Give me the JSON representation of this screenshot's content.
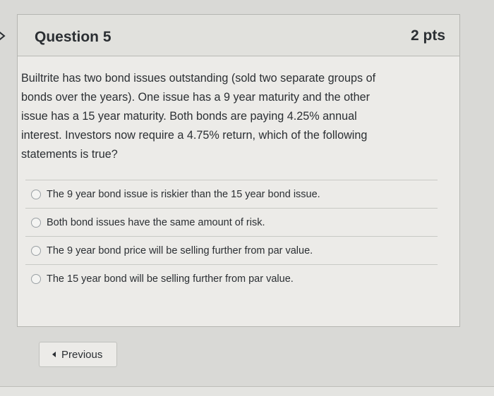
{
  "question": {
    "title": "Question 5",
    "points": "2 pts",
    "text_lines": [
      "Builtrite has two bond issues outstanding (sold two separate groups of",
      "bonds over the years). One issue has a 9 year maturity and the other",
      "issue has a 15 year maturity. Both bonds are paying 4.25% annual",
      "interest. Investors now require a 4.75% return, which of the following",
      "statements is true?"
    ],
    "answers": [
      "The 9 year bond issue is riskier than the 15 year bond issue.",
      "Both bond issues have the same amount of risk.",
      "The 9 year bond price will be selling further from par value.",
      "The 15 year bond will be selling further from par value."
    ]
  },
  "navigation": {
    "previous_label": "Previous"
  },
  "icons": {
    "left_arrow": "chevron-left-icon",
    "previous": "caret-left-icon"
  }
}
